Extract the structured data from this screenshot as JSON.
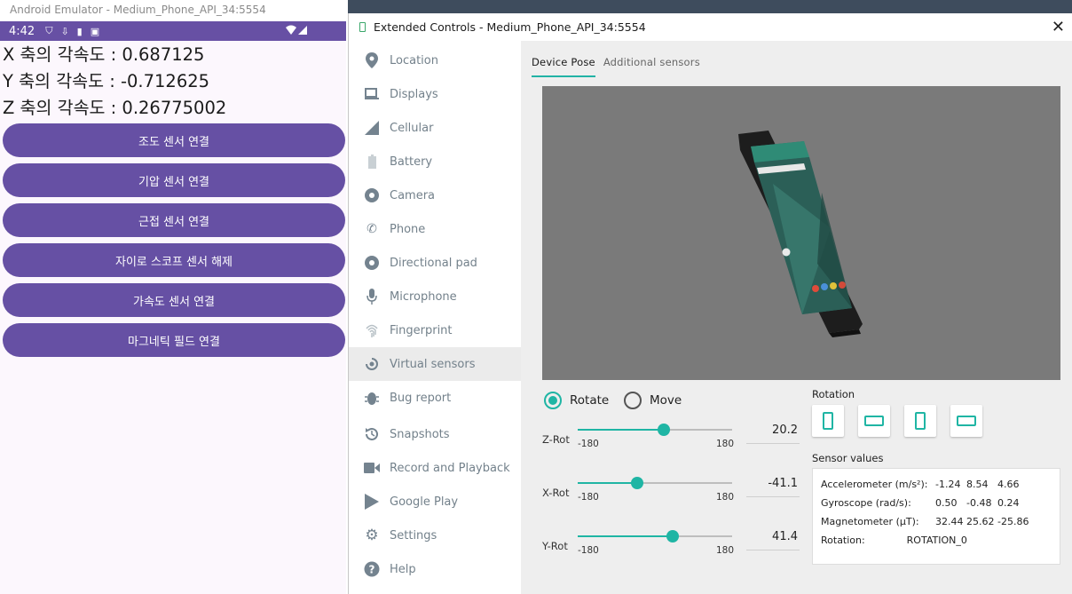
{
  "emulator": {
    "window_title": "Android Emulator - Medium_Phone_API_34:5554",
    "status_time": "4:42",
    "lines": [
      "X 축의 각속도 : 0.687125",
      "Y 축의 각속도 : -0.712625",
      "Z 축의 각속도 : 0.26775002"
    ],
    "buttons": [
      "조도 센서 연결",
      "기압 센서 연결",
      "근접 센서 연결",
      "자이로 스코프 센서 해제",
      "가속도 센서 연결",
      "마그네틱 필드 연결"
    ]
  },
  "extended": {
    "window_title": "Extended Controls - Medium_Phone_API_34:5554",
    "nav": [
      {
        "label": "Location",
        "icon": "location-icon"
      },
      {
        "label": "Displays",
        "icon": "display-icon"
      },
      {
        "label": "Cellular",
        "icon": "cellular-icon"
      },
      {
        "label": "Battery",
        "icon": "battery-icon"
      },
      {
        "label": "Camera",
        "icon": "camera-icon"
      },
      {
        "label": "Phone",
        "icon": "phone-icon"
      },
      {
        "label": "Directional pad",
        "icon": "dpad-icon"
      },
      {
        "label": "Microphone",
        "icon": "microphone-icon"
      },
      {
        "label": "Fingerprint",
        "icon": "fingerprint-icon"
      },
      {
        "label": "Virtual sensors",
        "icon": "virtual-sensors-icon"
      },
      {
        "label": "Bug report",
        "icon": "bug-icon"
      },
      {
        "label": "Snapshots",
        "icon": "snapshots-icon"
      },
      {
        "label": "Record and Playback",
        "icon": "video-icon"
      },
      {
        "label": "Google Play",
        "icon": "google-play-icon"
      },
      {
        "label": "Settings",
        "icon": "gear-icon"
      },
      {
        "label": "Help",
        "icon": "help-icon"
      }
    ],
    "tabs": [
      "Device Pose",
      "Additional sensors"
    ],
    "rotate_label": "Rotate",
    "move_label": "Move",
    "sliders": [
      {
        "name": "Z-Rot",
        "min": "-180",
        "max": "180",
        "value": "20.2",
        "numeric": 20.2
      },
      {
        "name": "X-Rot",
        "min": "-180",
        "max": "180",
        "value": "-41.1",
        "numeric": -41.1
      },
      {
        "name": "Y-Rot",
        "min": "-180",
        "max": "180",
        "value": "41.4",
        "numeric": 41.4
      }
    ],
    "rotation_label": "Rotation",
    "sensor_values_label": "Sensor values",
    "sensor_values": {
      "accel": {
        "label": "Accelerometer (m/s²):",
        "v": [
          "-1.24",
          "8.54",
          "4.66"
        ]
      },
      "gyro": {
        "label": "Gyroscope (rad/s):",
        "v": [
          "0.50",
          "-0.48",
          "0.24"
        ]
      },
      "mag": {
        "label": "Magnetometer (μT):",
        "v": [
          "32.44",
          "25.62",
          "-25.86"
        ]
      },
      "rot": {
        "label": "Rotation:",
        "v": "ROTATION_0"
      }
    },
    "accent_color": "#1fb5a4"
  }
}
